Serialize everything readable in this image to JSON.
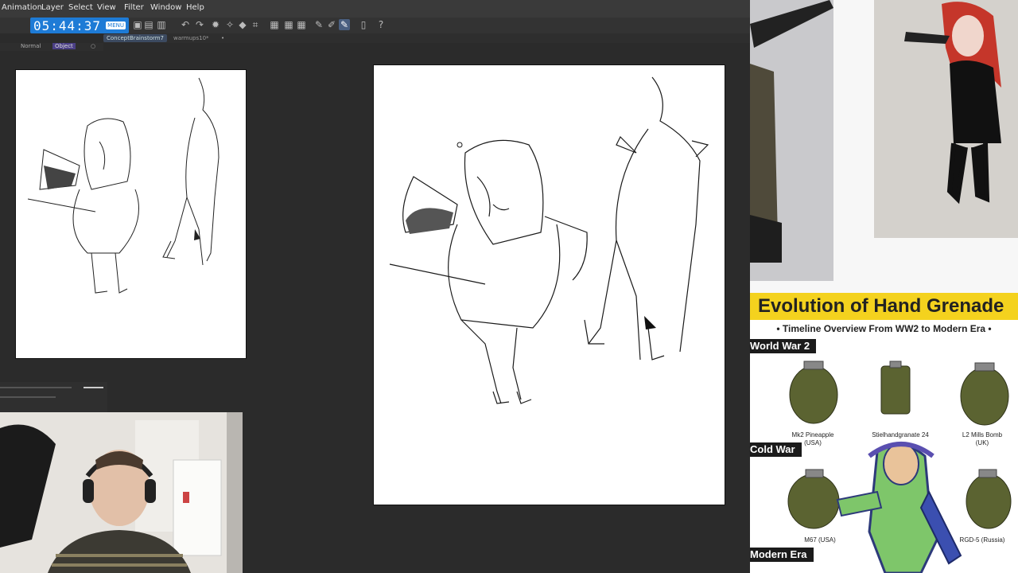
{
  "menubar": {
    "items": [
      "Animation",
      "Layer",
      "Select",
      "View",
      "Filter",
      "Window",
      "Help"
    ]
  },
  "timer": {
    "time": "05:44:37",
    "menu_label": "MENU"
  },
  "tabs": [
    {
      "label": "ConceptBrainstorm7",
      "active": true
    },
    {
      "label": "warmups10*",
      "active": false
    }
  ],
  "subbar": {
    "items": [
      "Normal",
      "Object"
    ]
  },
  "infographic": {
    "title": "Evolution of Hand Grenade",
    "subtitle": "• Timeline Overview From WW2 to Modern Era •",
    "eras": [
      "World War 2",
      "Cold War",
      "Modern Era"
    ],
    "grenades": [
      {
        "name": "Mk2 Pineapple",
        "country": "(USA)"
      },
      {
        "name": "Stielhandgranate 24",
        "country": ""
      },
      {
        "name": "L2 Mills Bomb",
        "country": "(UK)"
      },
      {
        "name": "M67 (USA)",
        "country": ""
      },
      {
        "name": "RGD-5 (Russia)",
        "country": ""
      }
    ]
  },
  "colors": {
    "accent": "#1e7bd6",
    "title_band": "#f4d21e",
    "app_bg": "#2b2b2b"
  }
}
